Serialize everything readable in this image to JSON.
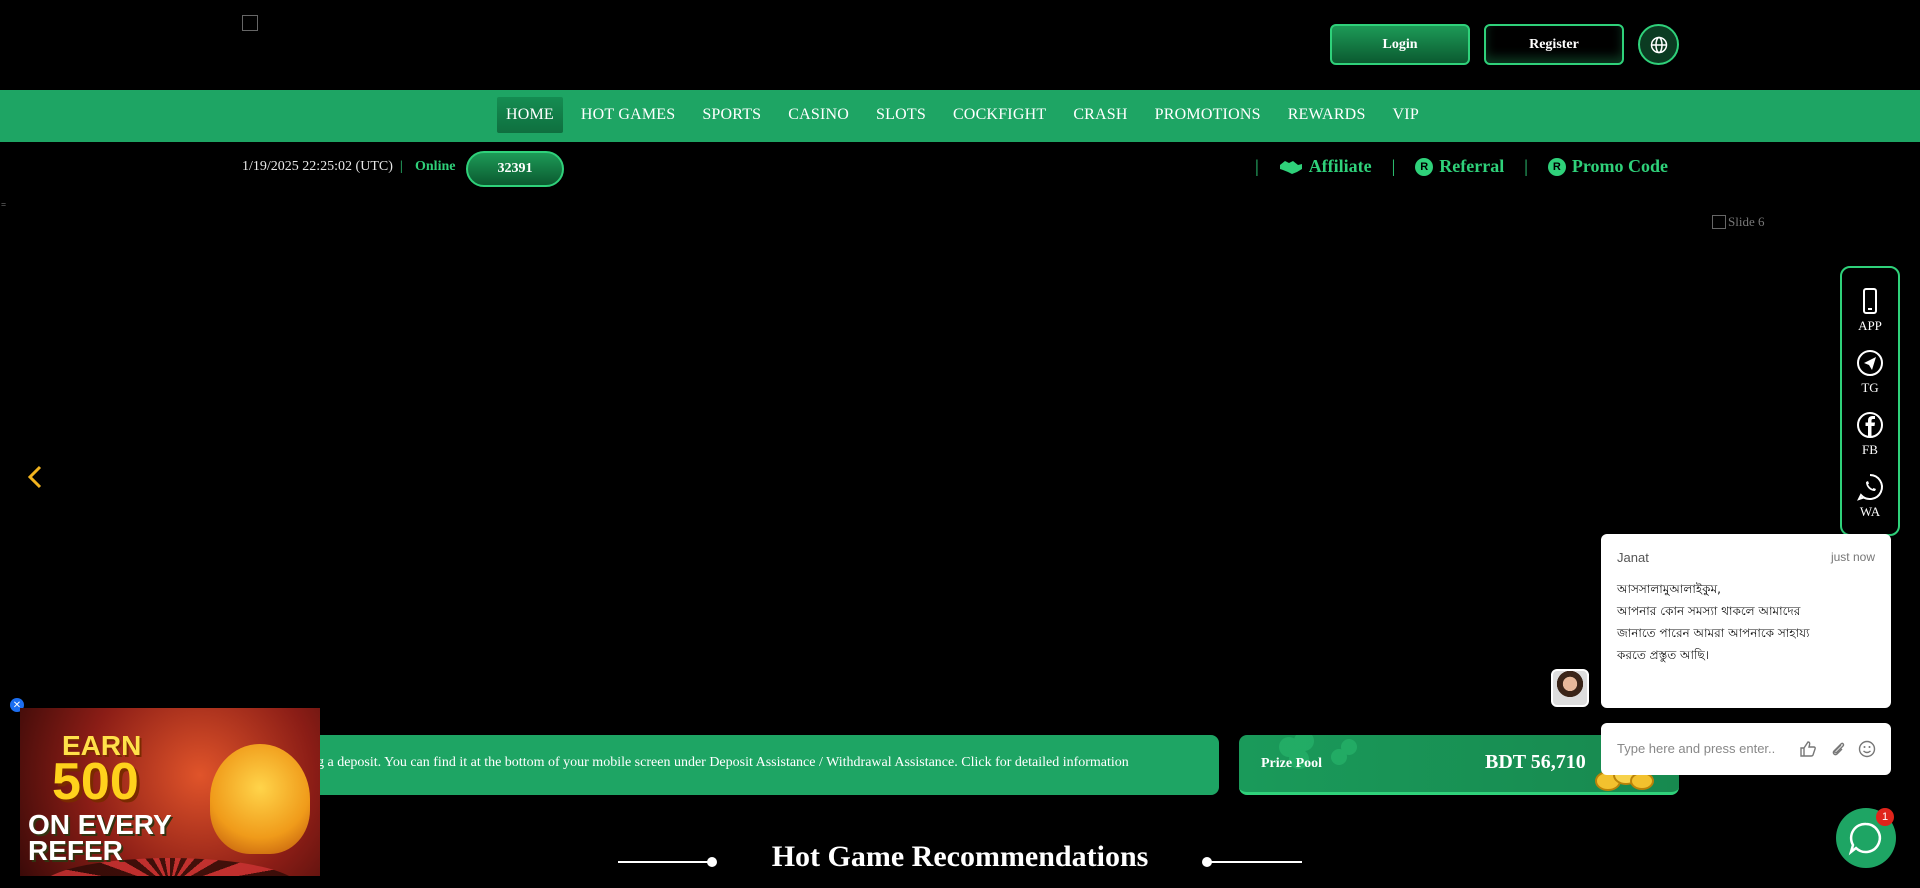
{
  "header": {
    "login_label": "Login",
    "register_label": "Register"
  },
  "nav": {
    "items": [
      "HOME",
      "HOT GAMES",
      "SPORTS",
      "CASINO",
      "SLOTS",
      "COCKFIGHT",
      "CRASH",
      "PROMOTIONS",
      "REWARDS",
      "VIP"
    ],
    "active": "HOME"
  },
  "infobar": {
    "datetime": "1/19/2025 22:25:02 (UTC)",
    "online_label": "Online",
    "online_count": "32391",
    "links": {
      "affiliate": "Affiliate",
      "referral": "Referral",
      "promo_code": "Promo Code"
    }
  },
  "banner": {
    "slide_alt": "Slide 6"
  },
  "social": {
    "items": [
      "APP",
      "TG",
      "FB",
      "WA"
    ]
  },
  "ticker": {
    "text": "ng a deposit. You can find it at the bottom of your mobile screen under Deposit Assistance / Withdrawal Assistance. Click for detailed information"
  },
  "prize_pool": {
    "label": "Prize Pool",
    "value": "BDT 56,710"
  },
  "section": {
    "title": "Hot Game Recommendations"
  },
  "promo": {
    "line1": "EARN",
    "line2": "500",
    "line3": "ON EVERY",
    "line4": "REFER"
  },
  "chat": {
    "agent": "Janat",
    "time": "just now",
    "message_lines": [
      "আসসালামুআলাইকুম,",
      "আপনার কোন সমস্যা থাকলে আমাদের",
      "জানাতে পারেন আমরা আপনাকে সাহায্য",
      "করতে প্রস্তুত আছি।"
    ],
    "input_placeholder": "Type here and press enter..",
    "badge": "1"
  },
  "colors": {
    "accent": "#2fd17a",
    "nav_bg": "#1ea564",
    "page_bg": "#000000"
  }
}
